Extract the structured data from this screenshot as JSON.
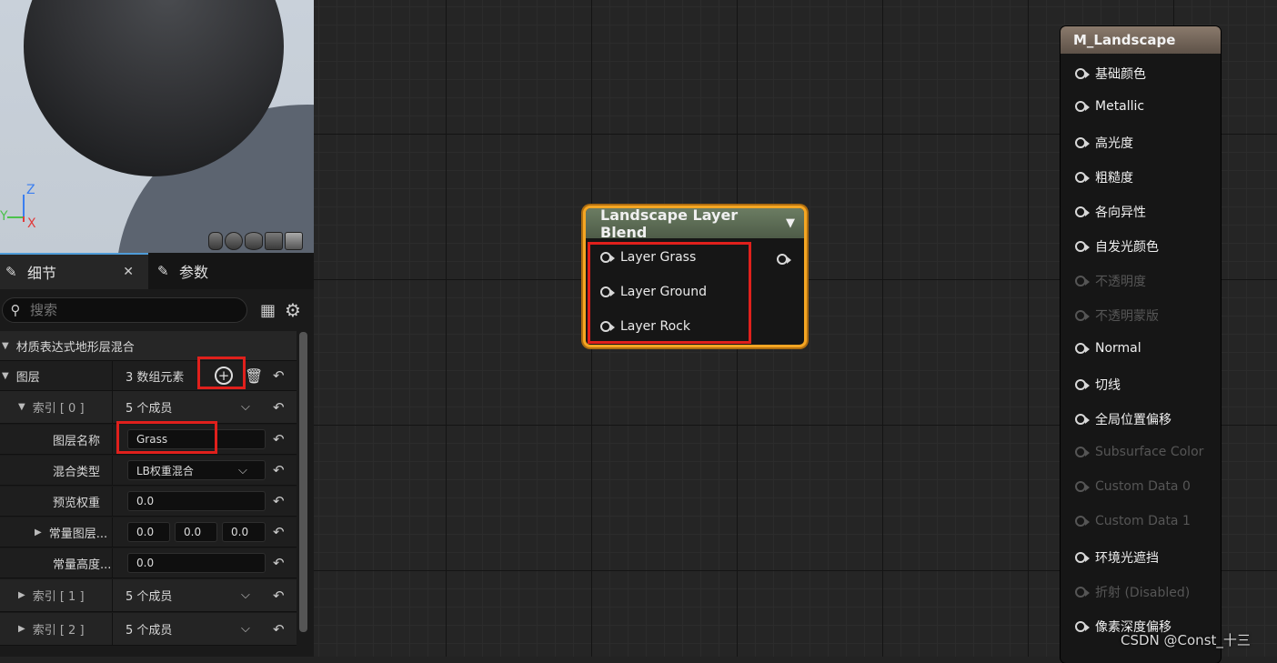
{
  "viewport": {
    "axis_z": "Z",
    "axis_y": "Y",
    "axis_x": "X",
    "preview_shapes": [
      "cylinder-icon",
      "sphere-icon",
      "plane-icon",
      "cube-icon",
      "teapot-icon"
    ]
  },
  "details": {
    "tab_details": "细节",
    "tab_params": "参数",
    "search_placeholder": "搜索",
    "section_title": "材质表达式地形层混合",
    "layers_label": "图层",
    "layers_count": "3 数组元素",
    "index0": {
      "label": "索引 [ 0 ]",
      "value": "5 个成员"
    },
    "layer_name": {
      "label": "图层名称",
      "value": "Grass"
    },
    "blend_type": {
      "label": "混合类型",
      "value": "LB权重混合"
    },
    "preview_weight": {
      "label": "预览权重",
      "value": "0.0"
    },
    "const_layer": {
      "label": "常量图层...",
      "v1": "0.0",
      "v2": "0.0",
      "v3": "0.0"
    },
    "const_height": {
      "label": "常量高度...",
      "value": "0.0"
    },
    "index1": {
      "label": "索引 [ 1 ]",
      "value": "5 个成员"
    },
    "index2": {
      "label": "索引 [ 2 ]",
      "value": "5 个成员"
    }
  },
  "blend_node": {
    "title": "Landscape Layer Blend",
    "inputs": [
      "Layer Grass",
      "Layer Ground",
      "Layer Rock"
    ]
  },
  "material_node": {
    "title": "M_Landscape",
    "pins": [
      {
        "label": "基础颜色",
        "active": true
      },
      {
        "label": "Metallic",
        "active": true
      },
      {
        "label": "高光度",
        "active": true
      },
      {
        "label": "粗糙度",
        "active": true
      },
      {
        "label": "各向异性",
        "active": true
      },
      {
        "label": "自发光颜色",
        "active": true
      },
      {
        "label": "不透明度",
        "active": false
      },
      {
        "label": "不透明蒙版",
        "active": false
      },
      {
        "label": "Normal",
        "active": true
      },
      {
        "label": "切线",
        "active": true
      },
      {
        "label": "全局位置偏移",
        "active": true
      },
      {
        "label": "Subsurface Color",
        "active": false
      },
      {
        "label": "Custom Data 0",
        "active": false
      },
      {
        "label": "Custom Data 1",
        "active": false
      },
      {
        "label": "环境光遮挡",
        "active": true
      },
      {
        "label": "折射 (Disabled)",
        "active": false
      },
      {
        "label": "像素深度偏移",
        "active": true
      }
    ]
  },
  "watermark": "CSDN @Const_十三",
  "colors": {
    "highlight": "#e0201c",
    "selection": "#f5a623"
  }
}
